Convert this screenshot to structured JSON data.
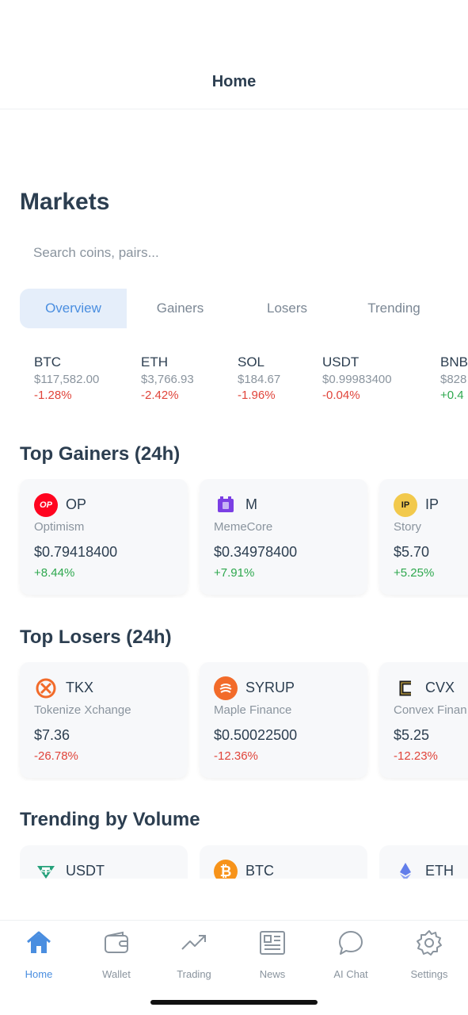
{
  "header": {
    "title": "Home"
  },
  "page": {
    "title": "Markets"
  },
  "search": {
    "placeholder": "Search coins, pairs..."
  },
  "tabs": [
    {
      "label": "Overview",
      "active": true
    },
    {
      "label": "Gainers",
      "active": false
    },
    {
      "label": "Losers",
      "active": false
    },
    {
      "label": "Trending",
      "active": false
    }
  ],
  "ticker": [
    {
      "symbol": "BTC",
      "price": "$117,582.00",
      "change": "-1.28%",
      "direction": "down"
    },
    {
      "symbol": "ETH",
      "price": "$3,766.93",
      "change": "-2.42%",
      "direction": "down"
    },
    {
      "symbol": "SOL",
      "price": "$184.67",
      "change": "-1.96%",
      "direction": "down"
    },
    {
      "symbol": "USDT",
      "price": "$0.99983400",
      "change": "-0.04%",
      "direction": "down"
    },
    {
      "symbol": "BNB",
      "price": "$828",
      "change": "+0.4",
      "direction": "up"
    }
  ],
  "top_gainers": {
    "title": "Top Gainers (24h)",
    "items": [
      {
        "symbol": "OP",
        "name": "Optimism",
        "price": "$0.79418400",
        "change": "+8.44%",
        "icon": "optimism-icon",
        "icon_color": "#ff0420",
        "icon_text": "OP"
      },
      {
        "symbol": "M",
        "name": "MemeCore",
        "price": "$0.34978400",
        "change": "+7.91%",
        "icon": "memecore-icon",
        "icon_color": "#7b3fe4",
        "icon_text": ""
      },
      {
        "symbol": "IP",
        "name": "Story",
        "price": "$5.70",
        "change": "+5.25%",
        "icon": "story-icon",
        "icon_color": "#f2c94c",
        "icon_text": "IP"
      }
    ]
  },
  "top_losers": {
    "title": "Top Losers (24h)",
    "items": [
      {
        "symbol": "TKX",
        "name": "Tokenize Xchange",
        "price": "$7.36",
        "change": "-26.78%",
        "icon": "tokenize-icon",
        "icon_color": "#f26b2a",
        "icon_text": ""
      },
      {
        "symbol": "SYRUP",
        "name": "Maple Finance",
        "price": "$0.50022500",
        "change": "-12.36%",
        "icon": "maple-icon",
        "icon_color": "#f26b2a",
        "icon_text": ""
      },
      {
        "symbol": "CVX",
        "name": "Convex Finan",
        "price": "$5.25",
        "change": "-12.23%",
        "icon": "convex-icon",
        "icon_color": "#1b1b1b",
        "icon_text": ""
      }
    ]
  },
  "trending": {
    "title": "Trending by Volume",
    "items": [
      {
        "symbol": "USDT",
        "icon": "tether-icon",
        "icon_color": "#26a17b"
      },
      {
        "symbol": "BTC",
        "icon": "bitcoin-icon",
        "icon_color": "#f7931a"
      },
      {
        "symbol": "ETH",
        "icon": "ethereum-icon",
        "icon_color": "#627eea"
      }
    ]
  },
  "nav": [
    {
      "label": "Home",
      "icon": "home-icon",
      "active": true
    },
    {
      "label": "Wallet",
      "icon": "wallet-icon",
      "active": false
    },
    {
      "label": "Trading",
      "icon": "trending-up-icon",
      "active": false
    },
    {
      "label": "News",
      "icon": "newspaper-icon",
      "active": false
    },
    {
      "label": "AI Chat",
      "icon": "chat-bubble-icon",
      "active": false
    },
    {
      "label": "Settings",
      "icon": "gear-icon",
      "active": false
    }
  ],
  "colors": {
    "accent": "#4a8ee0",
    "positive": "#2ea84e",
    "negative": "#e0443a"
  }
}
